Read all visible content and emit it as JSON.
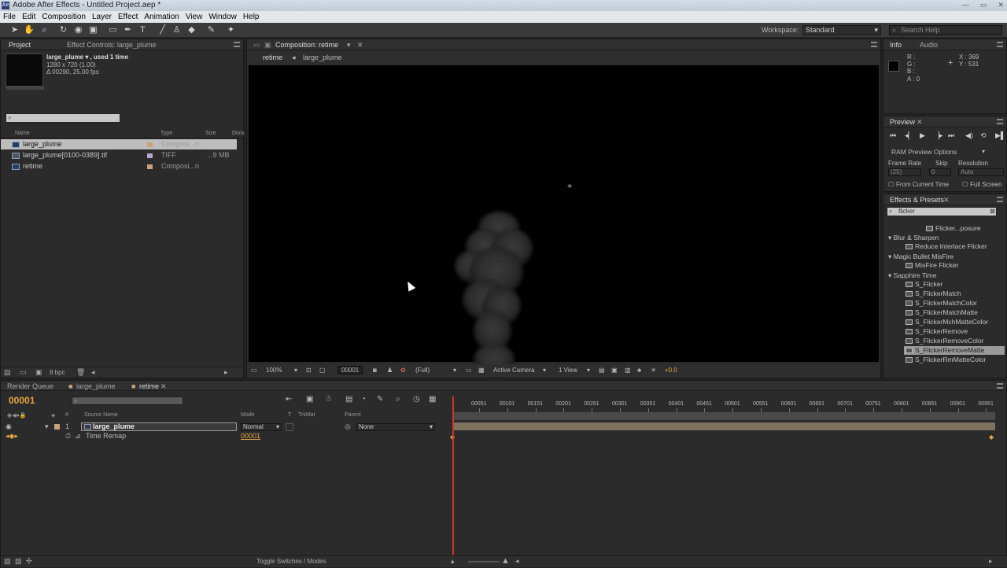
{
  "window": {
    "title": "Adobe After Effects - Untitled Project.aep *",
    "app_icon": "Ae"
  },
  "menu": [
    "File",
    "Edit",
    "Composition",
    "Layer",
    "Effect",
    "Animation",
    "View",
    "Window",
    "Help"
  ],
  "toolbar": {
    "workspace_label": "Workspace:",
    "workspace_value": "Standard",
    "help_placeholder": "Search Help"
  },
  "project": {
    "tab_project": "Project",
    "tab_effect_controls": "Effect Controls: large_plume",
    "item_name": "large_plume ▾ , used 1 time",
    "item_dims": "1280 x 720 (1.00)",
    "item_duration": "Δ 00290, 25.00 fps",
    "columns": {
      "name": "Name",
      "type": "Type",
      "size": "Size",
      "duration": "Dura"
    },
    "items": [
      {
        "name": "large_plume",
        "type": "Composi...n",
        "size": ""
      },
      {
        "name": "large_plume[0100-0389].tif",
        "type": "TIFF",
        "size": "...9 MB"
      },
      {
        "name": "retime",
        "type": "Composi...n",
        "size": ""
      }
    ],
    "bpc": "8 bpc"
  },
  "composition": {
    "tab": "Composition: retime",
    "breadcrumb": [
      "retime",
      "large_plume"
    ],
    "footer": {
      "zoom": "100%",
      "timecode": "00001",
      "resolution": "(Full)",
      "camera": "Active Camera",
      "view": "1 View",
      "exposure": "+0.0"
    }
  },
  "info": {
    "tabs": [
      "Info",
      "Audio"
    ],
    "r": "R :",
    "g": "G :",
    "b": "B :",
    "a": "A : 0",
    "x": "X : 369",
    "y": "Y : 531"
  },
  "preview": {
    "tab": "Preview",
    "ram_options": "RAM Preview Options",
    "frame_rate_label": "Frame Rate",
    "skip_label": "Skip",
    "resolution_label": "Resolution",
    "frame_rate_value": "(25)",
    "skip_value": "0",
    "resolution_value": "Auto",
    "from_current_time": "From Current Time",
    "full_screen": "Full Screen"
  },
  "effects": {
    "tab": "Effects & Presets",
    "search_value": "flicker",
    "partial_top": "Flicker...posure",
    "categories": [
      {
        "name": "Blur & Sharpen",
        "items": [
          "Reduce Interlace Flicker"
        ]
      },
      {
        "name": "Magic Bullet MisFire",
        "items": [
          "MisFire Flicker"
        ]
      },
      {
        "name": "Sapphire Time",
        "items": [
          "S_Flicker",
          "S_FlickerMatch",
          "S_FlickerMatchColor",
          "S_FlickerMatchMatte",
          "S_FlickerMchMatteColor",
          "S_FlickerRemove",
          "S_FlickerRemoveColor",
          "S_FlickerRemoveMatte",
          "S_FlickerRmMatteColor"
        ]
      }
    ],
    "selected": "S_FlickerRemoveMatte"
  },
  "timeline": {
    "tabs": [
      "Render Queue",
      "large_plume",
      "retime"
    ],
    "timecode": "00001",
    "columns": {
      "num": "#",
      "source": "Source Name",
      "mode": "Mode",
      "t": "T",
      "trkmat": "TrkMat",
      "parent": "Parent"
    },
    "layer": {
      "index": "1",
      "name": "large_plume",
      "mode": "Normal",
      "parent": "None"
    },
    "property": {
      "name": "Time Remap",
      "value": "00001"
    },
    "ruler": [
      "00051",
      "00101",
      "00151",
      "00201",
      "00251",
      "00301",
      "00351",
      "00401",
      "00451",
      "00501",
      "00551",
      "00601",
      "00651",
      "00701",
      "00751",
      "00801",
      "00851",
      "00901",
      "00951"
    ],
    "footer": "Toggle Switches / Modes"
  }
}
